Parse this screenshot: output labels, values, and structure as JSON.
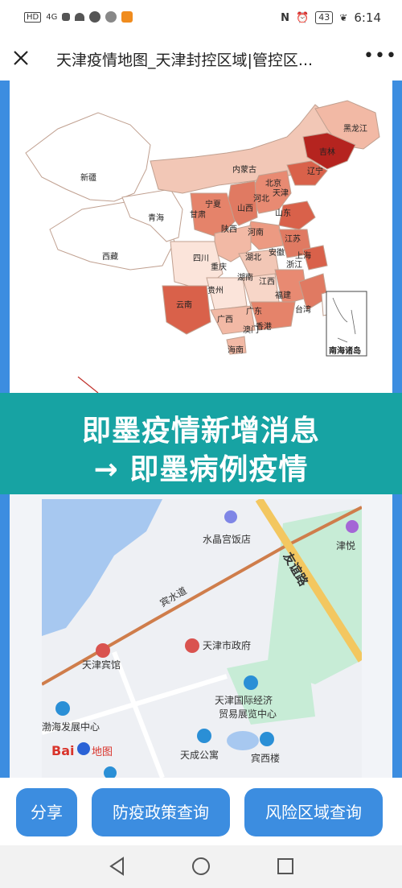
{
  "status_bar": {
    "left_badges": "HD",
    "network": "4G",
    "battery": "43",
    "time": "6:14"
  },
  "nav": {
    "title": "天津疫情地图_天津封控区域|管控区...",
    "more_label": "•••"
  },
  "china_map": {
    "provinces": [
      "黑龙江",
      "吉林",
      "辽宁",
      "内蒙古",
      "北京",
      "天津",
      "河北",
      "新疆",
      "宁夏",
      "甘肃",
      "山西",
      "山东",
      "青海",
      "陕西",
      "河南",
      "江苏",
      "西藏",
      "四川",
      "湖北",
      "安徽",
      "上海",
      "重庆",
      "浙江",
      "湖南",
      "江西",
      "贵州",
      "福建",
      "云南",
      "广西",
      "广东",
      "台湾",
      "澳门",
      "香港",
      "海南"
    ],
    "inset_label": "南海诸岛"
  },
  "banner": {
    "line1": "即墨疫情新增消息",
    "line2": "→ 即墨病例疫情"
  },
  "street_map": {
    "labels": {
      "hotel_crystal": "水晶宫饭店",
      "tianjin_hotel": "天津宾馆",
      "gov": "天津市政府",
      "road_binshui": "宾水道",
      "road_youyi": "友谊路",
      "expo": "天津国际经济",
      "expo2": "贸易展览中心",
      "bohai": "渤海发展中心",
      "tiancheng": "天成公寓",
      "binxi": "宾西楼",
      "jinyue": "津悦",
      "baidu": "Bai",
      "baidu2": "地图"
    }
  },
  "buttons": {
    "share": "分享",
    "policy": "防疫政策查询",
    "risk": "风险区域查询"
  },
  "colors": {
    "accent_blue": "#3c8de0",
    "banner_teal": "#17a3a3",
    "map_dark_red": "#b5241f",
    "map_mid": "#d9614a",
    "map_light": "#f2b9a5"
  }
}
